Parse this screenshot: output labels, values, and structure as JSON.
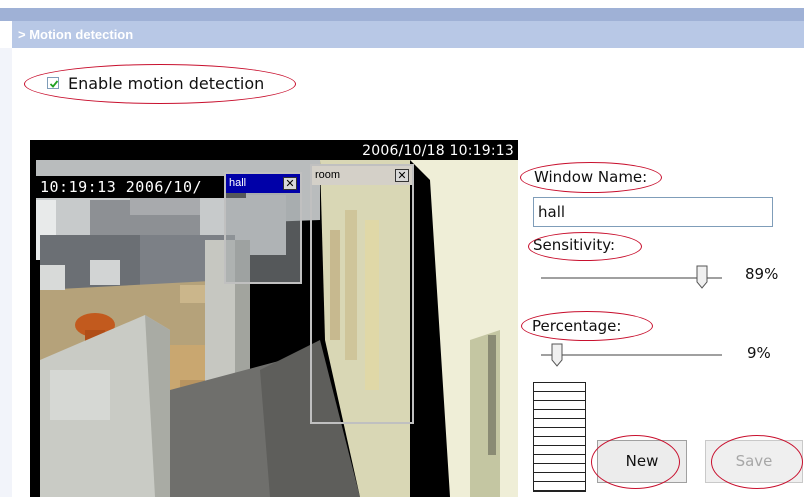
{
  "section": {
    "title": "> Motion detection"
  },
  "enable": {
    "label": "Enable motion detection",
    "checked": true
  },
  "video": {
    "timestamp_top": "2006/10/18 10:19:13",
    "timestamp_overlay": "10:19:13 2006/10/",
    "windows": [
      {
        "name": "hall",
        "active": true,
        "close_glyph": "✕"
      },
      {
        "name": "room",
        "active": false,
        "close_glyph": "✕"
      }
    ]
  },
  "form": {
    "window_name_label": "Window Name:",
    "window_name_value": "hall",
    "sensitivity_label": "Sensitivity:",
    "sensitivity_value": 89,
    "sensitivity_text": "89%",
    "percentage_label": "Percentage:",
    "percentage_value": 9,
    "percentage_text": "9%"
  },
  "buttons": {
    "new_label": "New",
    "save_label": "Save",
    "save_enabled": false
  },
  "colors": {
    "header_bg": "#b8c8e6",
    "annotation": "#c8102e",
    "active_title": "#0000a8"
  }
}
